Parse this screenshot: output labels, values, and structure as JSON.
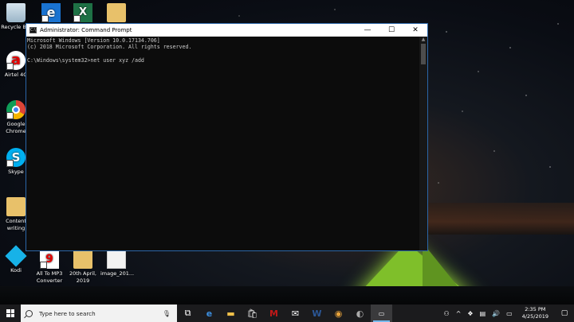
{
  "desktop": {
    "icons": [
      {
        "label": "Recycle Bin",
        "icon": "recycle-bin-icon"
      },
      {
        "label": "",
        "icon": "edge-icon"
      },
      {
        "label": "",
        "icon": "excel-icon"
      },
      {
        "label": "",
        "icon": "folder-icon"
      },
      {
        "label": "Airtel 4G",
        "icon": "airtel-icon"
      },
      {
        "label": "Google Chrome",
        "icon": "chrome-icon"
      },
      {
        "label": "Skype",
        "icon": "skype-icon"
      },
      {
        "label": "Content writing",
        "icon": "folder-icon"
      },
      {
        "label": "Kodi",
        "icon": "kodi-icon"
      },
      {
        "label": "All To MP3 Converter",
        "icon": "mp3-converter-icon"
      },
      {
        "label": "20th April, 2019",
        "icon": "folder-icon"
      },
      {
        "label": "image_201...",
        "icon": "image-file-icon"
      }
    ]
  },
  "window": {
    "title": "Administrator: Command Prompt",
    "app_icon_text": "C:\\",
    "minimize": "—",
    "maximize": "☐",
    "close": "✕",
    "console_lines": [
      "Microsoft Windows [Version 10.0.17134.706]",
      "(c) 2018 Microsoft Corporation. All rights reserved.",
      "",
      "C:\\Windows\\system32>net user xyz /add"
    ]
  },
  "taskbar": {
    "search_placeholder": "Type here to search",
    "apps": [
      "task-view-icon",
      "edge-icon",
      "file-explorer-icon",
      "store-icon",
      "mcafee-icon",
      "mail-icon",
      "word-icon",
      "chrome-icon",
      "app-icon",
      "command-prompt-icon"
    ],
    "tray": {
      "time": "2:35 PM",
      "date": "4/25/2019"
    }
  },
  "colors": {
    "console_bg": "#0c0c0c",
    "console_text": "#cccccc",
    "taskbar": "#1b1b1d",
    "active_indicator": "#76b9ed"
  }
}
